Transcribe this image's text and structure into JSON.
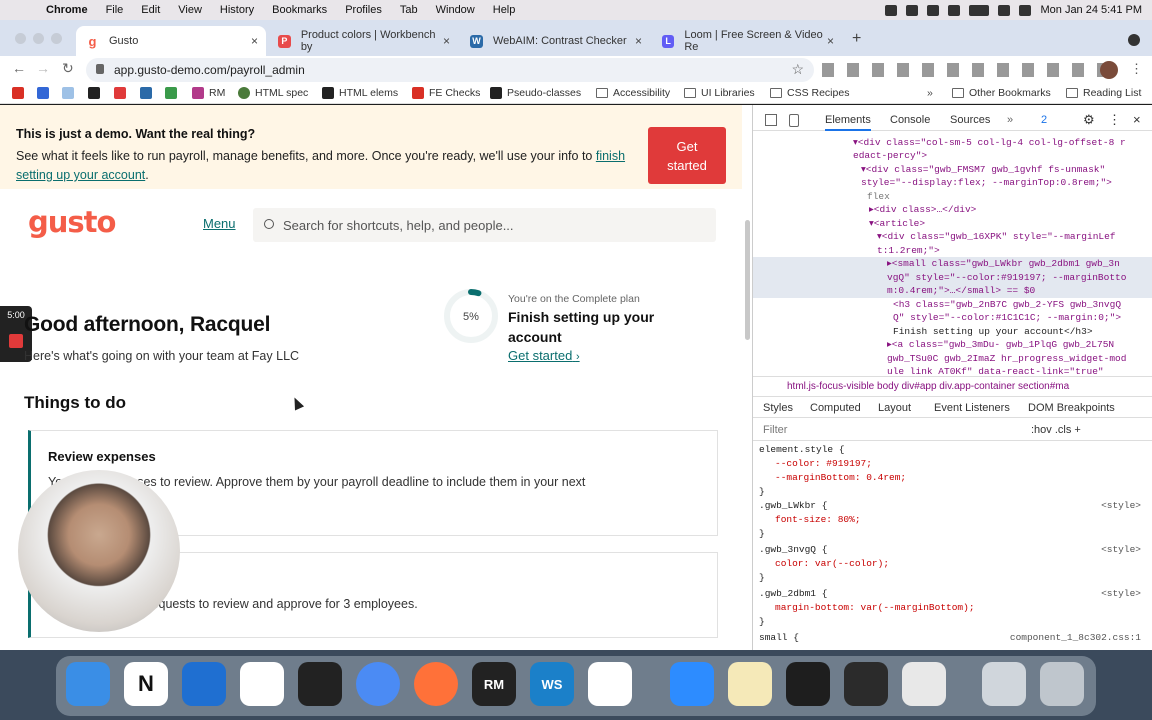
{
  "menubar": {
    "app": "Chrome",
    "items": [
      "File",
      "Edit",
      "View",
      "History",
      "Bookmarks",
      "Profiles",
      "Tab",
      "Window",
      "Help"
    ],
    "clock": "Mon Jan 24  5:41 PM"
  },
  "tabs": [
    {
      "label": "Gusto",
      "favicon": "g",
      "color": "#f45d48"
    },
    {
      "label": "Product colors | Workbench by",
      "favicon": "P",
      "color": "#e84b4b"
    },
    {
      "label": "WebAIM: Contrast Checker",
      "favicon": "W",
      "color": "#2b6aa8"
    },
    {
      "label": "Loom | Free Screen & Video Re",
      "favicon": "L",
      "color": "#625df5"
    }
  ],
  "url": "app.gusto-demo.com/payroll_admin",
  "bookmarks": [
    "RM",
    "HTML spec",
    "HTML elems",
    "FE Checks",
    "Pseudo-classes",
    "Accessibility",
    "UI Libraries",
    "CSS Recipes",
    "Other Bookmarks",
    "Reading List"
  ],
  "banner": {
    "title": "This is just a demo. Want the real thing?",
    "text": "See what it feels like to run payroll, manage benefits, and more. Once you're ready, we'll use your info to",
    "link": "finish setting up your account",
    "after": ".",
    "button": "Get started"
  },
  "header": {
    "logo": "gusto",
    "menu": "Menu",
    "search_placeholder": "Search for shortcuts, help, and people..."
  },
  "loom_timer": "5:00",
  "greeting": "Good afternoon, Racquel",
  "subtitle": "Here's what's going on with your team at Fay LLC",
  "progress": {
    "percent_label": "5%",
    "percent": 5,
    "plan": "You're on the Complete plan",
    "title": "Finish setting up your account",
    "link": "Get started"
  },
  "things_title": "Things to do",
  "cards": [
    {
      "title": "Review expenses",
      "desc": "You have expenses to review. Approve them by your payroll deadline to include them in your next"
    },
    {
      "title": "",
      "desc": "You have time off requests to review and approve for 3 employees."
    }
  ],
  "devtools": {
    "tabs": [
      "Elements",
      "Console",
      "Sources"
    ],
    "issues": "2",
    "code": [
      "▾<div class=\"col-sm-5 col-lg-4 col-lg-offset-8 r",
      "  edact-percy\">",
      "  ▾<div class=\"gwb_FMSM7 gwb_1gvhf fs-unmask\"",
      "   style=\"--display:flex; --marginTop:0.8rem;\">",
      "    flex",
      "   ▸<div class>…</div>",
      "   ▾<article>",
      "    ▾<div class=\"gwb_16XPK\" style=\"--marginLef",
      "     t:1.2rem;\">",
      "      ▸<small class=\"gwb_LWkbr gwb_2dbm1 gwb_3n",
      "      vgQ\" style=\"--color:#919197; --marginBotto",
      "      m:0.4rem;\">…</small> == $0",
      "       <h3 class=\"gwb_2nB7C gwb_2-YFS gwb_3nvgQ",
      "       Q\" style=\"--color:#1C1C1C; --margin:0;\">",
      "       Finish setting up your account</h3>",
      "      ▸<a class=\"gwb_3mDu- gwb_1PlqG gwb_2L75N",
      "      gwb_TSu0C gwb_2ImaZ hr_progress_widget-mod",
      "      ule  link  AT0Kf\" data-react-link=\"true\""
    ],
    "breadcrumbs": "html.js-focus-visible   body   div#app   div.app-container   section#ma",
    "style_tabs": [
      "Styles",
      "Computed",
      "Layout",
      "Event Listeners",
      "DOM Breakpoints"
    ],
    "filter": "Filter",
    "filter_right": ":hov  .cls  +",
    "rules": [
      {
        "sel": "element.style {",
        "lines": [
          "--color: #919197;",
          "--marginBottom: 0.4rem;"
        ],
        "src": ""
      },
      {
        "sel": ".gwb_LWkbr {",
        "lines": [
          "font-size: 80%;"
        ],
        "src": "<style>"
      },
      {
        "sel": ".gwb_3nvgQ {",
        "lines": [
          "color: var(--color);"
        ],
        "src": "<style>"
      },
      {
        "sel": ".gwb_2dbm1 {",
        "lines": [
          "margin-bottom: var(--marginBottom);"
        ],
        "src": "<style>"
      },
      {
        "sel": "small {",
        "lines": [],
        "src": "component_1_8c302.css:1"
      }
    ]
  },
  "dock": [
    "Finder",
    "Notion",
    "1Password",
    "Slack",
    "Terminal",
    "Chrome",
    "Firefox",
    "RM",
    "WS",
    "VS Code",
    "Zoom",
    "Notes",
    "Figma",
    "Activity",
    "Script",
    "Files",
    "Trash"
  ]
}
